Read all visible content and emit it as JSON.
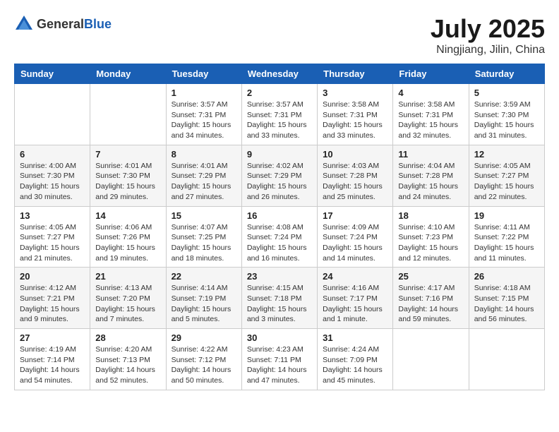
{
  "logo": {
    "text_general": "General",
    "text_blue": "Blue"
  },
  "title": {
    "month": "July 2025",
    "location": "Ningjiang, Jilin, China"
  },
  "headers": [
    "Sunday",
    "Monday",
    "Tuesday",
    "Wednesday",
    "Thursday",
    "Friday",
    "Saturday"
  ],
  "weeks": [
    [
      {
        "day": "",
        "info": ""
      },
      {
        "day": "",
        "info": ""
      },
      {
        "day": "1",
        "info": "Sunrise: 3:57 AM\nSunset: 7:31 PM\nDaylight: 15 hours\nand 34 minutes."
      },
      {
        "day": "2",
        "info": "Sunrise: 3:57 AM\nSunset: 7:31 PM\nDaylight: 15 hours\nand 33 minutes."
      },
      {
        "day": "3",
        "info": "Sunrise: 3:58 AM\nSunset: 7:31 PM\nDaylight: 15 hours\nand 33 minutes."
      },
      {
        "day": "4",
        "info": "Sunrise: 3:58 AM\nSunset: 7:31 PM\nDaylight: 15 hours\nand 32 minutes."
      },
      {
        "day": "5",
        "info": "Sunrise: 3:59 AM\nSunset: 7:30 PM\nDaylight: 15 hours\nand 31 minutes."
      }
    ],
    [
      {
        "day": "6",
        "info": "Sunrise: 4:00 AM\nSunset: 7:30 PM\nDaylight: 15 hours\nand 30 minutes."
      },
      {
        "day": "7",
        "info": "Sunrise: 4:01 AM\nSunset: 7:30 PM\nDaylight: 15 hours\nand 29 minutes."
      },
      {
        "day": "8",
        "info": "Sunrise: 4:01 AM\nSunset: 7:29 PM\nDaylight: 15 hours\nand 27 minutes."
      },
      {
        "day": "9",
        "info": "Sunrise: 4:02 AM\nSunset: 7:29 PM\nDaylight: 15 hours\nand 26 minutes."
      },
      {
        "day": "10",
        "info": "Sunrise: 4:03 AM\nSunset: 7:28 PM\nDaylight: 15 hours\nand 25 minutes."
      },
      {
        "day": "11",
        "info": "Sunrise: 4:04 AM\nSunset: 7:28 PM\nDaylight: 15 hours\nand 24 minutes."
      },
      {
        "day": "12",
        "info": "Sunrise: 4:05 AM\nSunset: 7:27 PM\nDaylight: 15 hours\nand 22 minutes."
      }
    ],
    [
      {
        "day": "13",
        "info": "Sunrise: 4:05 AM\nSunset: 7:27 PM\nDaylight: 15 hours\nand 21 minutes."
      },
      {
        "day": "14",
        "info": "Sunrise: 4:06 AM\nSunset: 7:26 PM\nDaylight: 15 hours\nand 19 minutes."
      },
      {
        "day": "15",
        "info": "Sunrise: 4:07 AM\nSunset: 7:25 PM\nDaylight: 15 hours\nand 18 minutes."
      },
      {
        "day": "16",
        "info": "Sunrise: 4:08 AM\nSunset: 7:24 PM\nDaylight: 15 hours\nand 16 minutes."
      },
      {
        "day": "17",
        "info": "Sunrise: 4:09 AM\nSunset: 7:24 PM\nDaylight: 15 hours\nand 14 minutes."
      },
      {
        "day": "18",
        "info": "Sunrise: 4:10 AM\nSunset: 7:23 PM\nDaylight: 15 hours\nand 12 minutes."
      },
      {
        "day": "19",
        "info": "Sunrise: 4:11 AM\nSunset: 7:22 PM\nDaylight: 15 hours\nand 11 minutes."
      }
    ],
    [
      {
        "day": "20",
        "info": "Sunrise: 4:12 AM\nSunset: 7:21 PM\nDaylight: 15 hours\nand 9 minutes."
      },
      {
        "day": "21",
        "info": "Sunrise: 4:13 AM\nSunset: 7:20 PM\nDaylight: 15 hours\nand 7 minutes."
      },
      {
        "day": "22",
        "info": "Sunrise: 4:14 AM\nSunset: 7:19 PM\nDaylight: 15 hours\nand 5 minutes."
      },
      {
        "day": "23",
        "info": "Sunrise: 4:15 AM\nSunset: 7:18 PM\nDaylight: 15 hours\nand 3 minutes."
      },
      {
        "day": "24",
        "info": "Sunrise: 4:16 AM\nSunset: 7:17 PM\nDaylight: 15 hours\nand 1 minute."
      },
      {
        "day": "25",
        "info": "Sunrise: 4:17 AM\nSunset: 7:16 PM\nDaylight: 14 hours\nand 59 minutes."
      },
      {
        "day": "26",
        "info": "Sunrise: 4:18 AM\nSunset: 7:15 PM\nDaylight: 14 hours\nand 56 minutes."
      }
    ],
    [
      {
        "day": "27",
        "info": "Sunrise: 4:19 AM\nSunset: 7:14 PM\nDaylight: 14 hours\nand 54 minutes."
      },
      {
        "day": "28",
        "info": "Sunrise: 4:20 AM\nSunset: 7:13 PM\nDaylight: 14 hours\nand 52 minutes."
      },
      {
        "day": "29",
        "info": "Sunrise: 4:22 AM\nSunset: 7:12 PM\nDaylight: 14 hours\nand 50 minutes."
      },
      {
        "day": "30",
        "info": "Sunrise: 4:23 AM\nSunset: 7:11 PM\nDaylight: 14 hours\nand 47 minutes."
      },
      {
        "day": "31",
        "info": "Sunrise: 4:24 AM\nSunset: 7:09 PM\nDaylight: 14 hours\nand 45 minutes."
      },
      {
        "day": "",
        "info": ""
      },
      {
        "day": "",
        "info": ""
      }
    ]
  ]
}
